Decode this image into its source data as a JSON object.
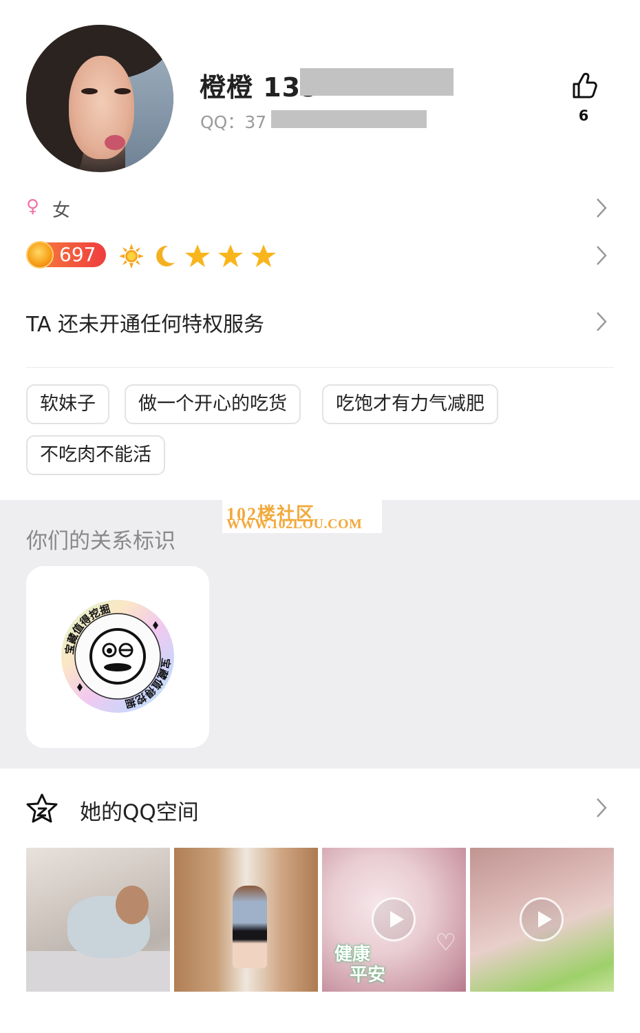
{
  "profile": {
    "name": "橙橙 139",
    "qq_label": "QQ：37",
    "likes": "6"
  },
  "gender": {
    "symbol": "♀",
    "label": "女"
  },
  "level": {
    "value": "697"
  },
  "privilege": {
    "text": "TA 还未开通任何特权服务"
  },
  "tags": [
    "软妹子",
    "做一个开心的吃货",
    "吃饱才有力气减肥",
    "不吃肉不能活"
  ],
  "relationship": {
    "title": "你们的关系标识",
    "badge_text": "宝藏值得挖掘"
  },
  "watermark": {
    "line1": "102楼社区",
    "line2": "WWW.102LOU.COM"
  },
  "qzone": {
    "title": "她的QQ空间",
    "photo3_caption_line1": "健康",
    "photo3_caption_line2": "平安"
  },
  "colors": {
    "gender_accent": "#f272a8",
    "level_badge": "#ef3c3f",
    "watermark": "#f2a93b",
    "section_bg": "#eeeef0"
  }
}
